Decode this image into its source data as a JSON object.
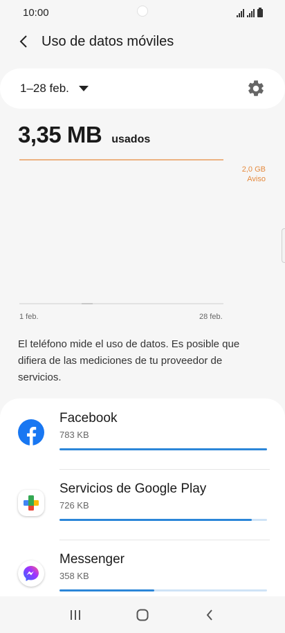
{
  "status_bar": {
    "time": "10:00"
  },
  "app_bar": {
    "title": "Uso de datos móviles"
  },
  "period": {
    "label": "1–28 feb."
  },
  "usage": {
    "value": "3,35 MB",
    "unit": "usados"
  },
  "chart": {
    "limit_value": "2,0 GB",
    "limit_label": "Aviso",
    "start_label": "1 feb.",
    "end_label": "28 feb.",
    "limit_color": "#e58a3e"
  },
  "note": "El teléfono mide el uso de datos. Es posible que difiera de las mediciones de tu proveedor de servicios.",
  "apps": [
    {
      "name": "Facebook",
      "size": "783 KB",
      "fraction": 1.0,
      "icon": "facebook-icon"
    },
    {
      "name": "Servicios de Google Play",
      "size": "726 KB",
      "fraction": 0.927,
      "icon": "google-play-services-icon"
    },
    {
      "name": "Messenger",
      "size": "358 KB",
      "fraction": 0.457,
      "icon": "messenger-icon"
    }
  ],
  "colors": {
    "accent": "#2b86d8",
    "accent_track": "#cfe3f6"
  }
}
